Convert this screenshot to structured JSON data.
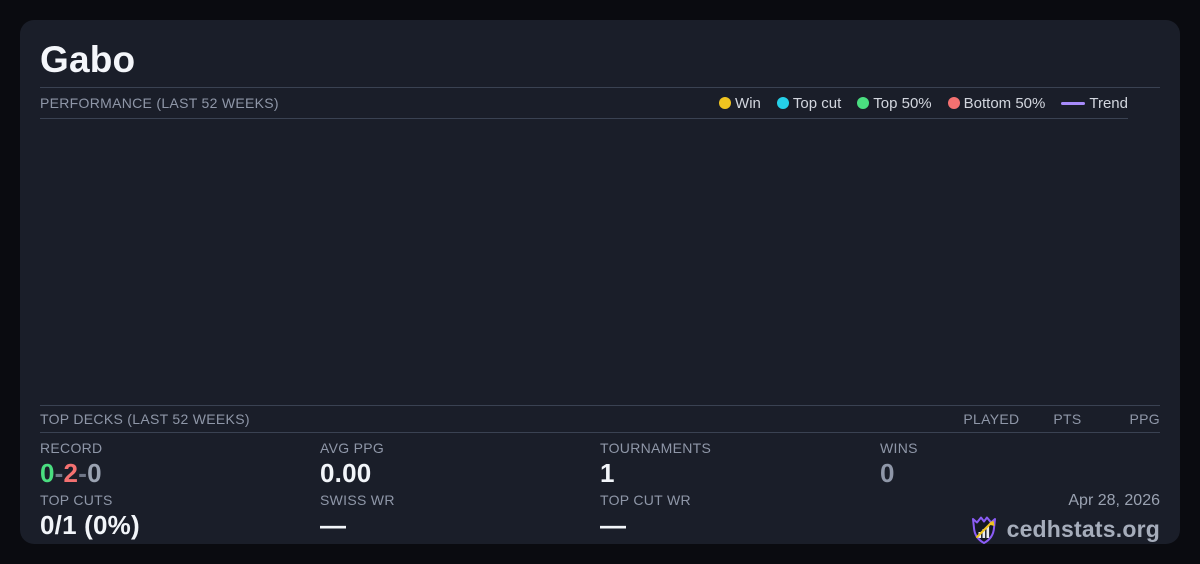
{
  "page": {
    "title": "Gabo"
  },
  "performance": {
    "heading": "PERFORMANCE (LAST 52 WEEKS)",
    "legend": [
      {
        "label": "Win",
        "color": "#f0c420",
        "type": "dot"
      },
      {
        "label": "Top cut",
        "color": "#25d0e8",
        "type": "dot"
      },
      {
        "label": "Top 50%",
        "color": "#4ade80",
        "type": "dot"
      },
      {
        "label": "Bottom 50%",
        "color": "#f47171",
        "type": "dot"
      },
      {
        "label": "Trend",
        "color": "#a78bfa",
        "type": "line"
      }
    ],
    "chart_empty": true
  },
  "top_decks": {
    "heading": "TOP DECKS (LAST 52 WEEKS)",
    "columns": {
      "played": "PLAYED",
      "pts": "PTS",
      "ppg": "PPG"
    },
    "rows": []
  },
  "stats": {
    "record": {
      "label": "RECORD",
      "wins": "0",
      "losses": "2",
      "draws": "0",
      "separator": "-"
    },
    "avg_ppg": {
      "label": "AVG PPG",
      "value": "0.00"
    },
    "tournaments": {
      "label": "TOURNAMENTS",
      "value": "1"
    },
    "wins": {
      "label": "WINS",
      "value": "0"
    },
    "top_cuts": {
      "label": "TOP CUTS",
      "value": "0/1 (0%)"
    },
    "swiss_wr": {
      "label": "SWISS WR",
      "value": "—"
    },
    "top_cut_wr": {
      "label": "TOP CUT WR",
      "value": "—"
    }
  },
  "footer": {
    "date": "Apr 28, 2026",
    "brand": "cedhstats.org"
  },
  "colors": {
    "card_bg": "#1a1e29",
    "page_bg": "#0a0b10",
    "divider": "#3a4252",
    "label_gray": "#8f97a8",
    "value_white": "#f2f5f9",
    "record_win_green": "#4ade80",
    "record_loss_red": "#f47171",
    "trend_purple": "#a78bfa",
    "logo_purple": "#8b5cf6",
    "logo_arrow_yellow": "#f0c420"
  }
}
